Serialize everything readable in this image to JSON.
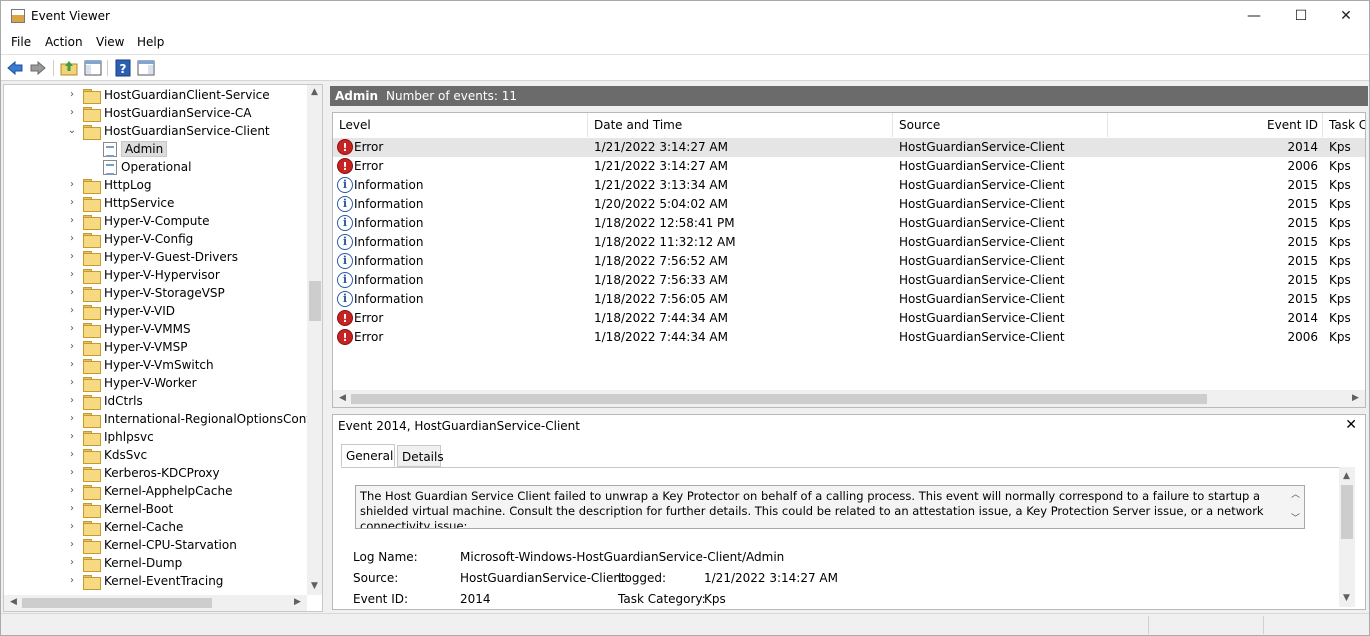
{
  "window": {
    "title": "Event Viewer",
    "minimize": "—",
    "maximize": "☐",
    "close": "✕"
  },
  "menu": [
    "File",
    "Action",
    "View",
    "Help"
  ],
  "tree": {
    "items": [
      {
        "label": "HostGuardianClient-Service",
        "expanded": false,
        "type": "folder"
      },
      {
        "label": "HostGuardianService-CA",
        "expanded": false,
        "type": "folder"
      },
      {
        "label": "HostGuardianService-Client",
        "expanded": true,
        "type": "folder"
      },
      {
        "label": "Admin",
        "type": "log",
        "selected": true
      },
      {
        "label": "Operational",
        "type": "log"
      },
      {
        "label": "HttpLog",
        "type": "folder"
      },
      {
        "label": "HttpService",
        "type": "folder"
      },
      {
        "label": "Hyper-V-Compute",
        "type": "folder"
      },
      {
        "label": "Hyper-V-Config",
        "type": "folder"
      },
      {
        "label": "Hyper-V-Guest-Drivers",
        "type": "folder"
      },
      {
        "label": "Hyper-V-Hypervisor",
        "type": "folder"
      },
      {
        "label": "Hyper-V-StorageVSP",
        "type": "folder"
      },
      {
        "label": "Hyper-V-VID",
        "type": "folder"
      },
      {
        "label": "Hyper-V-VMMS",
        "type": "folder"
      },
      {
        "label": "Hyper-V-VMSP",
        "type": "folder"
      },
      {
        "label": "Hyper-V-VmSwitch",
        "type": "folder"
      },
      {
        "label": "Hyper-V-Worker",
        "type": "folder"
      },
      {
        "label": "IdCtrls",
        "type": "folder"
      },
      {
        "label": "International-RegionalOptionsControll",
        "type": "folder"
      },
      {
        "label": "Iphlpsvc",
        "type": "folder"
      },
      {
        "label": "KdsSvc",
        "type": "folder"
      },
      {
        "label": "Kerberos-KDCProxy",
        "type": "folder"
      },
      {
        "label": "Kernel-ApphelpCache",
        "type": "folder"
      },
      {
        "label": "Kernel-Boot",
        "type": "folder"
      },
      {
        "label": "Kernel-Cache",
        "type": "folder"
      },
      {
        "label": "Kernel-CPU-Starvation",
        "type": "folder"
      },
      {
        "label": "Kernel-Dump",
        "type": "folder"
      },
      {
        "label": "Kernel-EventTracing",
        "type": "folder"
      }
    ]
  },
  "header": {
    "name": "Admin",
    "count": "Number of events: 11"
  },
  "columns": [
    "Level",
    "Date and Time",
    "Source",
    "Event ID",
    "Task Ca"
  ],
  "events": [
    {
      "level": "Error",
      "date": "1/21/2022 3:14:27 AM",
      "source": "HostGuardianService-Client",
      "id": "2014",
      "task": "Kps"
    },
    {
      "level": "Error",
      "date": "1/21/2022 3:14:27 AM",
      "source": "HostGuardianService-Client",
      "id": "2006",
      "task": "Kps"
    },
    {
      "level": "Information",
      "date": "1/21/2022 3:13:34 AM",
      "source": "HostGuardianService-Client",
      "id": "2015",
      "task": "Kps"
    },
    {
      "level": "Information",
      "date": "1/20/2022 5:04:02 AM",
      "source": "HostGuardianService-Client",
      "id": "2015",
      "task": "Kps"
    },
    {
      "level": "Information",
      "date": "1/18/2022 12:58:41 PM",
      "source": "HostGuardianService-Client",
      "id": "2015",
      "task": "Kps"
    },
    {
      "level": "Information",
      "date": "1/18/2022 11:32:12 AM",
      "source": "HostGuardianService-Client",
      "id": "2015",
      "task": "Kps"
    },
    {
      "level": "Information",
      "date": "1/18/2022 7:56:52 AM",
      "source": "HostGuardianService-Client",
      "id": "2015",
      "task": "Kps"
    },
    {
      "level": "Information",
      "date": "1/18/2022 7:56:33 AM",
      "source": "HostGuardianService-Client",
      "id": "2015",
      "task": "Kps"
    },
    {
      "level": "Information",
      "date": "1/18/2022 7:56:05 AM",
      "source": "HostGuardianService-Client",
      "id": "2015",
      "task": "Kps"
    },
    {
      "level": "Error",
      "date": "1/18/2022 7:44:34 AM",
      "source": "HostGuardianService-Client",
      "id": "2014",
      "task": "Kps"
    },
    {
      "level": "Error",
      "date": "1/18/2022 7:44:34 AM",
      "source": "HostGuardianService-Client",
      "id": "2006",
      "task": "Kps"
    }
  ],
  "detail": {
    "title": "Event 2014, HostGuardianService-Client",
    "close": "✕",
    "tabs": [
      "General",
      "Details"
    ],
    "description": "The Host Guardian Service Client failed to unwrap a Key Protector on behalf of a calling process. This event will normally correspond to a failure to startup a shielded virtual machine. Consult the description for further details. This could be related to an attestation issue, a Key Protection Server issue, or a network connectivity issue:",
    "log_name_label": "Log Name:",
    "log_name": "Microsoft-Windows-HostGuardianService-Client/Admin",
    "source_label": "Source:",
    "source": "HostGuardianService-Client",
    "logged_label": "Logged:",
    "logged": "1/21/2022 3:14:27 AM",
    "event_id_label": "Event ID:",
    "event_id": "2014",
    "task_label": "Task Category:",
    "task": "Kps"
  }
}
